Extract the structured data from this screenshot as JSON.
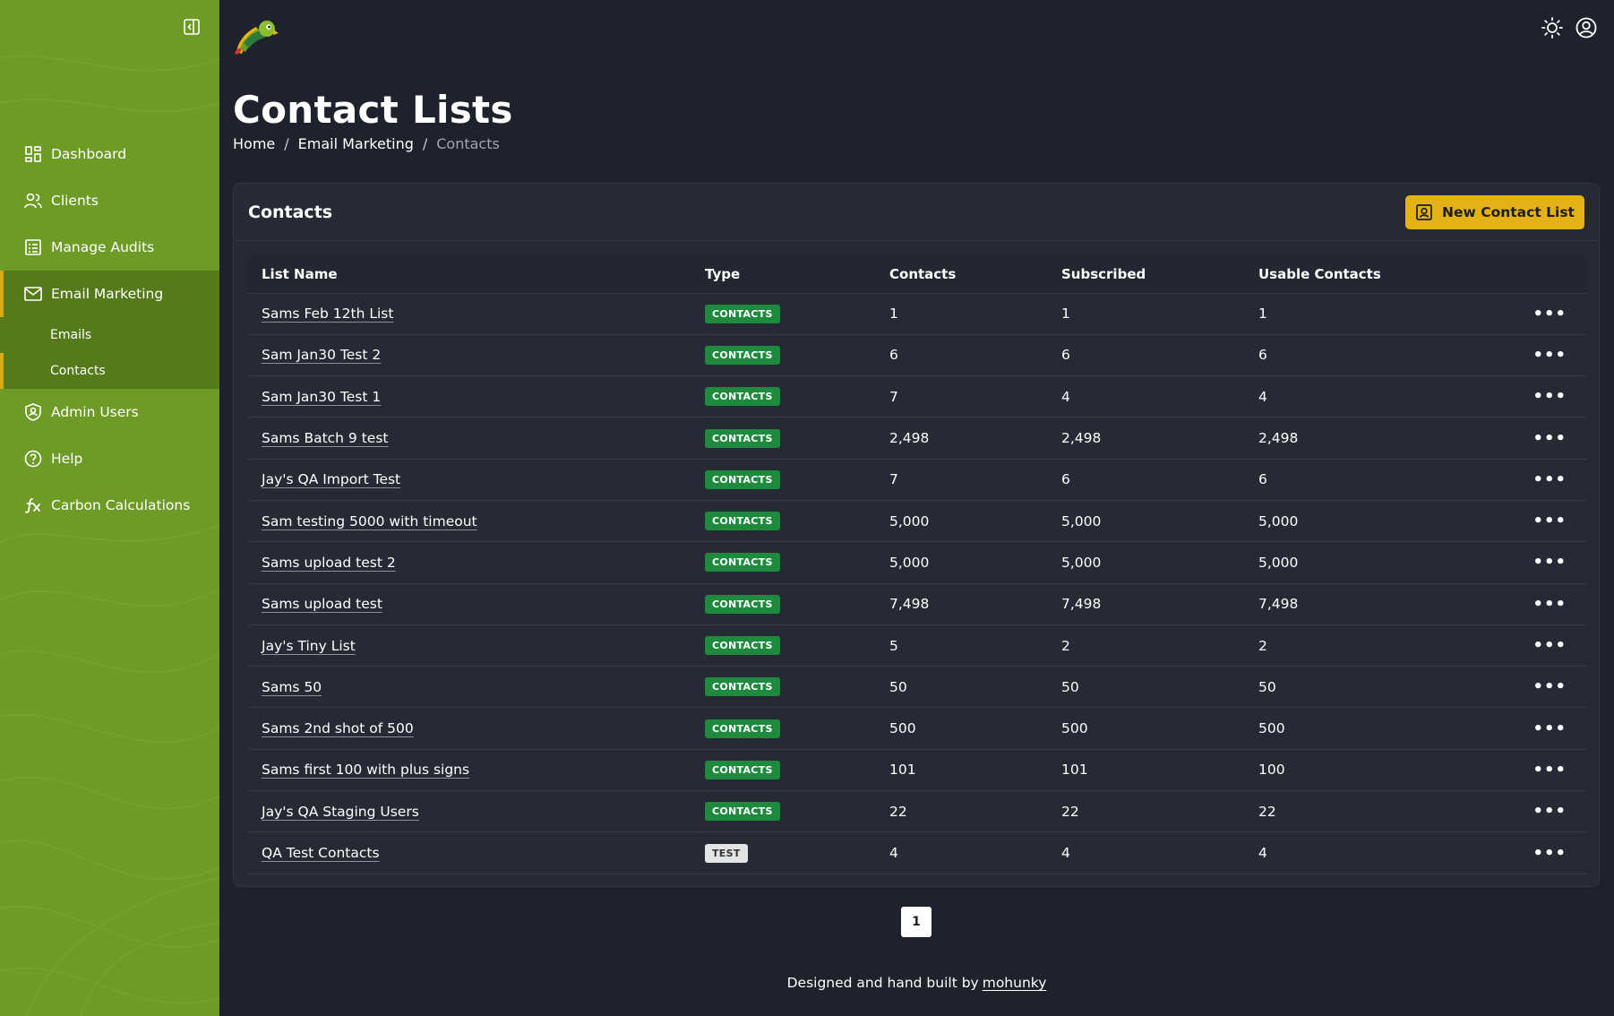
{
  "sidebar": {
    "items": [
      {
        "label": "Dashboard",
        "icon": "dashboard-icon"
      },
      {
        "label": "Clients",
        "icon": "users-icon"
      },
      {
        "label": "Manage Audits",
        "icon": "list-icon"
      },
      {
        "label": "Email Marketing",
        "icon": "mail-icon"
      },
      {
        "label": "Admin Users",
        "icon": "shield-user-icon"
      },
      {
        "label": "Help",
        "icon": "help-icon"
      },
      {
        "label": "Carbon Calculations",
        "icon": "function-icon"
      }
    ],
    "sub_items": [
      {
        "label": "Emails"
      },
      {
        "label": "Contacts"
      }
    ],
    "colors": {
      "background": "#6e9a26",
      "active_group": "#547a1a",
      "accent": "#d8aa14"
    }
  },
  "header": {
    "title": "Contact Lists",
    "breadcrumb": [
      "Home",
      "Email Marketing",
      "Contacts"
    ]
  },
  "card": {
    "title": "Contacts",
    "new_button_label": "New Contact List"
  },
  "table": {
    "columns": [
      "List Name",
      "Type",
      "Contacts",
      "Subscribed",
      "Usable Contacts"
    ],
    "rows": [
      {
        "name": "Sams Feb 12th List",
        "type": "CONTACTS",
        "contacts": "1",
        "subscribed": "1",
        "usable": "1"
      },
      {
        "name": "Sam Jan30 Test 2",
        "type": "CONTACTS",
        "contacts": "6",
        "subscribed": "6",
        "usable": "6"
      },
      {
        "name": "Sam Jan30 Test 1",
        "type": "CONTACTS",
        "contacts": "7",
        "subscribed": "4",
        "usable": "4"
      },
      {
        "name": "Sams Batch 9 test",
        "type": "CONTACTS",
        "contacts": "2,498",
        "subscribed": "2,498",
        "usable": "2,498"
      },
      {
        "name": "Jay's QA Import Test",
        "type": "CONTACTS",
        "contacts": "7",
        "subscribed": "6",
        "usable": "6"
      },
      {
        "name": "Sam testing 5000 with timeout",
        "type": "CONTACTS",
        "contacts": "5,000",
        "subscribed": "5,000",
        "usable": "5,000"
      },
      {
        "name": "Sams upload test 2",
        "type": "CONTACTS",
        "contacts": "5,000",
        "subscribed": "5,000",
        "usable": "5,000"
      },
      {
        "name": "Sams upload test",
        "type": "CONTACTS",
        "contacts": "7,498",
        "subscribed": "7,498",
        "usable": "7,498"
      },
      {
        "name": "Jay's Tiny List",
        "type": "CONTACTS",
        "contacts": "5",
        "subscribed": "2",
        "usable": "2"
      },
      {
        "name": "Sams 50",
        "type": "CONTACTS",
        "contacts": "50",
        "subscribed": "50",
        "usable": "50"
      },
      {
        "name": "Sams 2nd shot of 500",
        "type": "CONTACTS",
        "contacts": "500",
        "subscribed": "500",
        "usable": "500"
      },
      {
        "name": "Sams first 100 with plus signs",
        "type": "CONTACTS",
        "contacts": "101",
        "subscribed": "101",
        "usable": "100"
      },
      {
        "name": "Jay's QA Staging Users",
        "type": "CONTACTS",
        "contacts": "22",
        "subscribed": "22",
        "usable": "22"
      },
      {
        "name": "QA Test Contacts",
        "type": "TEST",
        "contacts": "4",
        "subscribed": "4",
        "usable": "4"
      }
    ],
    "menu_glyph": "•••"
  },
  "pagination": {
    "current_page": "1"
  },
  "footer": {
    "text": "Designed and hand built by",
    "link": "mohunky"
  },
  "colors": {
    "accent_button": "#e4b216",
    "badge_contacts": "#1d8a3d",
    "badge_test": "#e3e4e6",
    "background": "#1e222c"
  }
}
